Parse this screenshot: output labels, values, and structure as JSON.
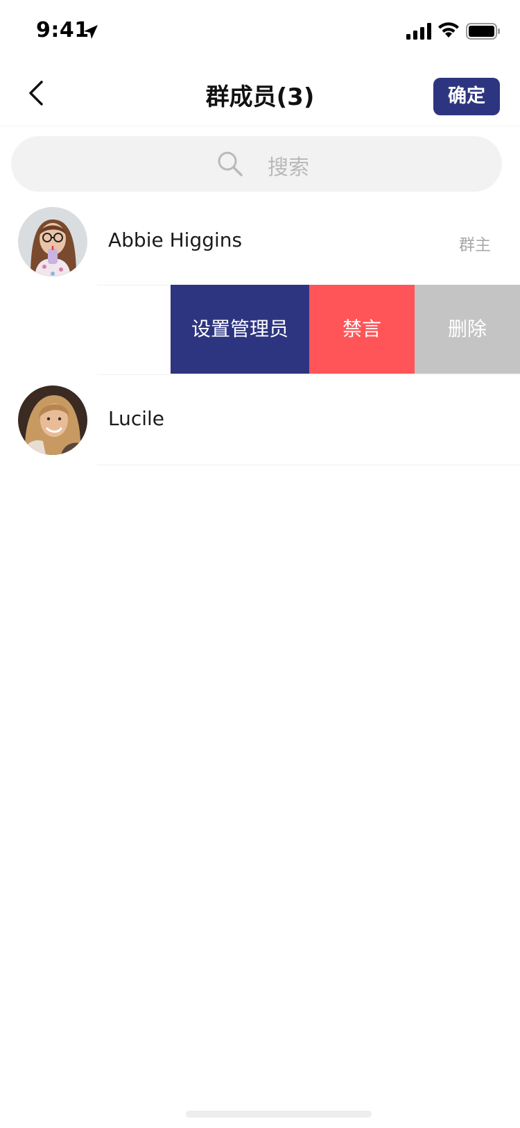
{
  "status_bar": {
    "time": "9:41"
  },
  "nav": {
    "title": "群成员(3)",
    "confirm_label": "确定"
  },
  "search": {
    "placeholder": "搜索"
  },
  "members": [
    {
      "name": "Abbie Higgins",
      "role": "群主"
    },
    {
      "name": "Lucile",
      "role": ""
    }
  ],
  "swipe_actions": {
    "set_admin_label": "设置管理员",
    "mute_label": "禁言",
    "delete_label": "删除"
  },
  "colors": {
    "primary": "#2E3580",
    "mute": "#FF5558",
    "delete": "#C4C4C4",
    "search_bg": "#F2F2F2",
    "placeholder": "#B9B9B9"
  }
}
